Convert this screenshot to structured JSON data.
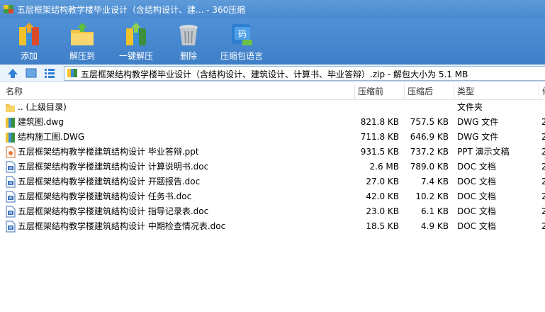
{
  "window": {
    "title": "五层框架结构教学楼毕业设计（含结构设计、建... - 360压缩"
  },
  "toolbar": [
    {
      "label": "添加",
      "icon": "add-archive-icon"
    },
    {
      "label": "解压到",
      "icon": "extract-to-icon"
    },
    {
      "label": "一键解压",
      "icon": "one-click-extract-icon"
    },
    {
      "label": "删除",
      "icon": "delete-bin-icon"
    },
    {
      "label": "压缩包语言",
      "icon": "archive-language-icon"
    }
  ],
  "address": {
    "path": "五层框架结构教学楼毕业设计（含结构设计、建筑设计、计算书、毕业答辩）.zip - 解包大小为 5.1 MB"
  },
  "columns": {
    "name": "名称",
    "compressed": "压缩前",
    "original": "压缩后",
    "type": "类型",
    "extra": "修"
  },
  "files": [
    {
      "name": ".. (上级目录)",
      "compressed": "",
      "original": "",
      "type": "文件夹",
      "icon": "folder-icon",
      "extra": ""
    },
    {
      "name": "建筑图.dwg",
      "compressed": "821.8 KB",
      "original": "757.5 KB",
      "type": "DWG 文件",
      "icon": "dwg-file-icon",
      "extra": "2"
    },
    {
      "name": "结构施工图.DWG",
      "compressed": "711.8 KB",
      "original": "646.9 KB",
      "type": "DWG 文件",
      "icon": "dwg-file-icon",
      "extra": "2"
    },
    {
      "name": "五层框架结构教学楼建筑结构设计 毕业答辩.ppt",
      "compressed": "931.5 KB",
      "original": "737.2 KB",
      "type": "PPT 演示文稿",
      "icon": "ppt-file-icon",
      "extra": "2"
    },
    {
      "name": "五层框架结构教学楼建筑结构设计 计算说明书.doc",
      "compressed": "2.6 MB",
      "original": "789.0 KB",
      "type": "DOC 文档",
      "icon": "doc-file-icon",
      "extra": "2"
    },
    {
      "name": "五层框架结构教学楼建筑结构设计 开题报告.doc",
      "compressed": "27.0 KB",
      "original": "7.4 KB",
      "type": "DOC 文档",
      "icon": "doc-file-icon",
      "extra": "2"
    },
    {
      "name": "五层框架结构教学楼建筑结构设计 任务书.doc",
      "compressed": "42.0 KB",
      "original": "10.2 KB",
      "type": "DOC 文档",
      "icon": "doc-file-icon",
      "extra": "2"
    },
    {
      "name": "五层框架结构教学楼建筑结构设计 指导记录表.doc",
      "compressed": "23.0 KB",
      "original": "6.1 KB",
      "type": "DOC 文档",
      "icon": "doc-file-icon",
      "extra": "2"
    },
    {
      "name": "五层框架结构教学楼建筑结构设计 中期检查情况表.doc",
      "compressed": "18.5 KB",
      "original": "4.9 KB",
      "type": "DOC 文档",
      "icon": "doc-file-icon",
      "extra": "2"
    }
  ]
}
